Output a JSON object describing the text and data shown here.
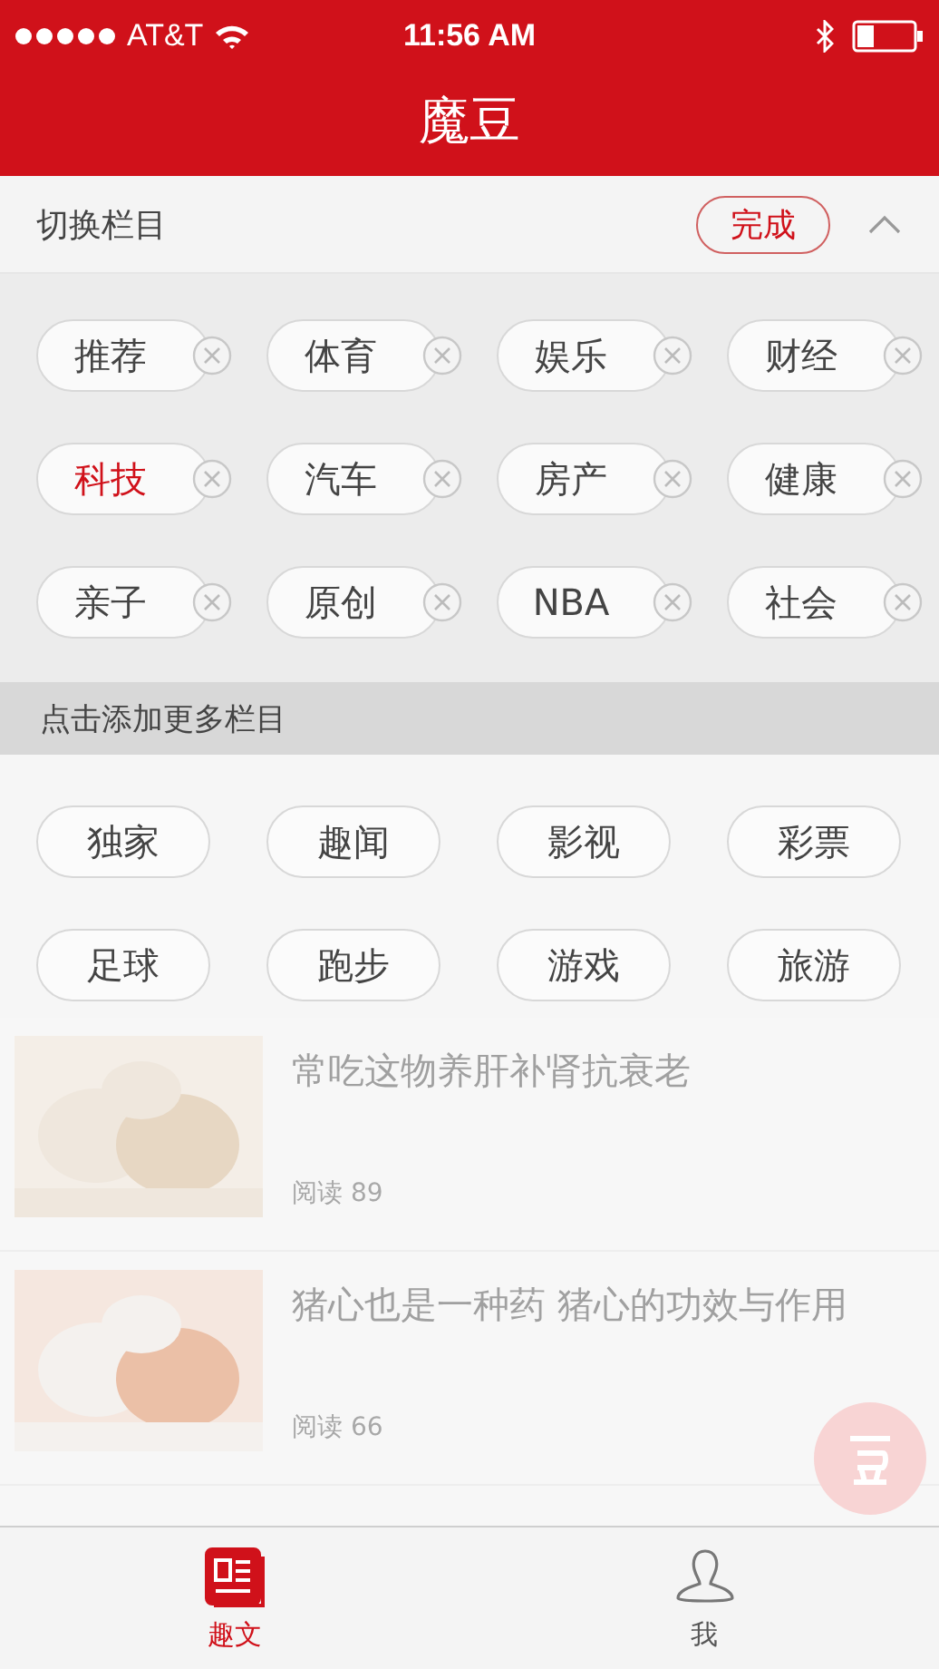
{
  "status_bar": {
    "carrier": "AT&T",
    "time": "11:56 AM"
  },
  "app_title": "魔豆",
  "editor": {
    "title": "切换栏目",
    "done_button": "完成",
    "my_channels": [
      {
        "label": "推荐",
        "selected": false
      },
      {
        "label": "体育",
        "selected": false
      },
      {
        "label": "娱乐",
        "selected": false
      },
      {
        "label": "财经",
        "selected": false
      },
      {
        "label": "科技",
        "selected": true
      },
      {
        "label": "汽车",
        "selected": false
      },
      {
        "label": "房产",
        "selected": false
      },
      {
        "label": "健康",
        "selected": false
      },
      {
        "label": "亲子",
        "selected": false
      },
      {
        "label": "原创",
        "selected": false
      },
      {
        "label": "NBA",
        "selected": false
      },
      {
        "label": "社会",
        "selected": false
      }
    ],
    "more_title": "点击添加更多栏目",
    "more_channels": [
      "独家",
      "趣闻",
      "影视",
      "彩票",
      "足球",
      "跑步",
      "游戏",
      "旅游"
    ]
  },
  "articles": [
    {
      "title": "常吃这物养肝补肾抗衰老",
      "reads": "阅读 89"
    },
    {
      "title": "猪心也是一种药  猪心的功效与作用",
      "reads": "阅读 66"
    }
  ],
  "tab_bar": [
    {
      "label": "趣文",
      "kind": "news",
      "selected": true
    },
    {
      "label": "我",
      "kind": "profile",
      "selected": false
    }
  ]
}
